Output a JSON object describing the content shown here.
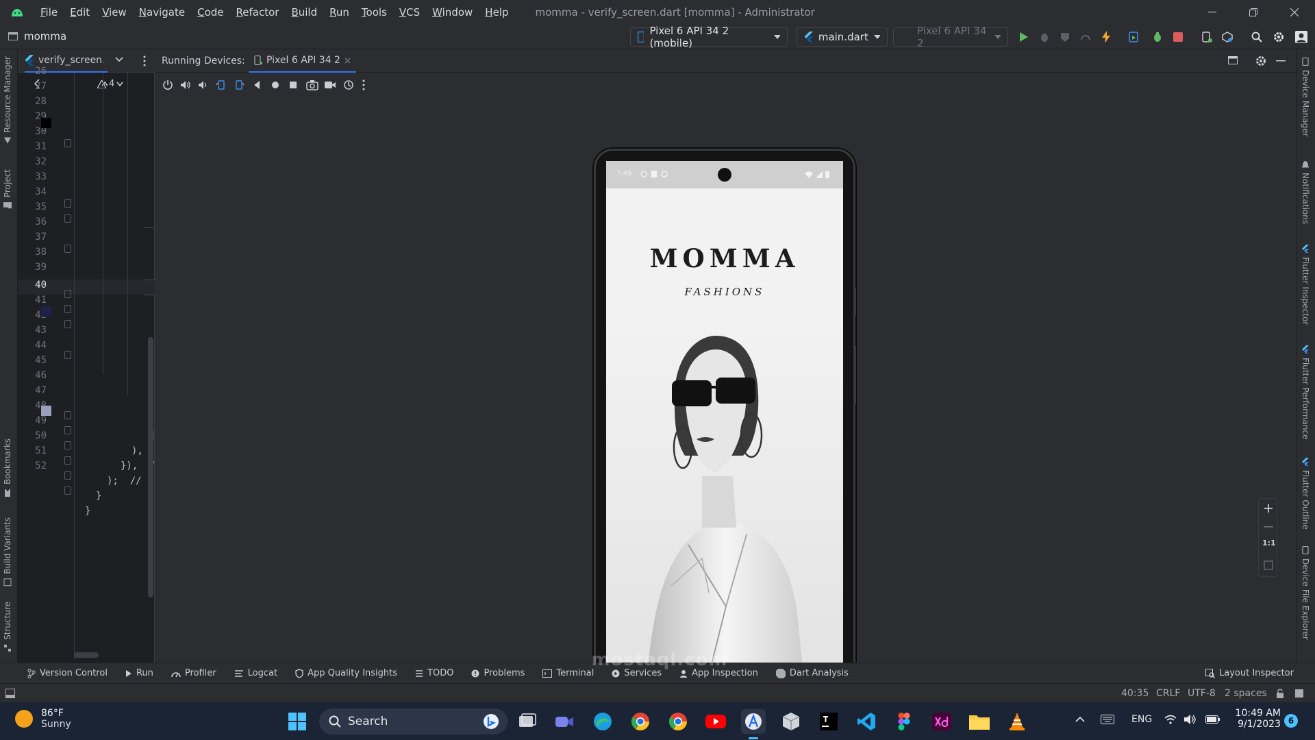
{
  "window": {
    "title": "momma - verify_screen.dart [momma] - Administrator",
    "menu": [
      "File",
      "Edit",
      "View",
      "Navigate",
      "Code",
      "Refactor",
      "Build",
      "Run",
      "Tools",
      "VCS",
      "Window",
      "Help"
    ]
  },
  "toolbar": {
    "project_name": "momma",
    "device_selector": "Pixel 6 API 34 2 (mobile)",
    "run_config": "main.dart",
    "disabled_device": "Pixel 6 API 34 2"
  },
  "left_stripe": {
    "resource_manager": "Resource Manager",
    "project": "Project",
    "bookmarks": "Bookmarks",
    "build_variants": "Build Variants",
    "structure": "Structure"
  },
  "editor": {
    "tab_label": "verify_screen.c",
    "warning_count": "4",
    "line_numbers": [
      "26",
      "27",
      "28",
      "29",
      "30",
      "31",
      "32",
      "33",
      "34",
      "35",
      "36",
      "37",
      "38",
      "39",
      "40",
      "41",
      "42",
      "43",
      "44",
      "45",
      "46",
      "47",
      "48",
      "49",
      "50",
      "51",
      "52"
    ],
    "code_46": "],",
    "code_47": "),",
    "code_48": "}),  /",
    "code_49": ");  // S",
    "code_50": "}",
    "code_51": "}"
  },
  "devices": {
    "panel_title": "Running Devices:",
    "active_tab": "Pixel 6 API 34 2",
    "phone": {
      "status_time": "7:49",
      "brand_title": "MOMMA",
      "brand_subtitle": "FASHIONS"
    },
    "zoom_reset": "1:1"
  },
  "right_stripe": {
    "device_manager": "Device Manager",
    "notifications": "Notifications",
    "flutter_inspector": "Flutter Inspector",
    "flutter_performance": "Flutter Performance",
    "flutter_outline": "Flutter Outline",
    "device_file_explorer": "Device File Explorer"
  },
  "bottom_tools": [
    "Version Control",
    "Run",
    "Profiler",
    "Logcat",
    "App Quality Insights",
    "TODO",
    "Problems",
    "Terminal",
    "Services",
    "App Inspection",
    "Dart Analysis"
  ],
  "layout_inspector": "Layout Inspector",
  "status": {
    "position": "40:35",
    "line_sep": "CRLF",
    "encoding": "UTF-8",
    "indent": "2 spaces"
  },
  "taskbar": {
    "weather_temp": "86°F",
    "weather_desc": "Sunny",
    "search_label": "Search",
    "language": "ENG",
    "time": "10:49 AM",
    "date": "9/1/2023",
    "notification_count": "6"
  },
  "watermark": "mostaql.com",
  "colors": {
    "accent": "#3574f0",
    "run_green": "#5fb865",
    "stop_red": "#db5c5c",
    "taskbar": "#1a2435"
  }
}
